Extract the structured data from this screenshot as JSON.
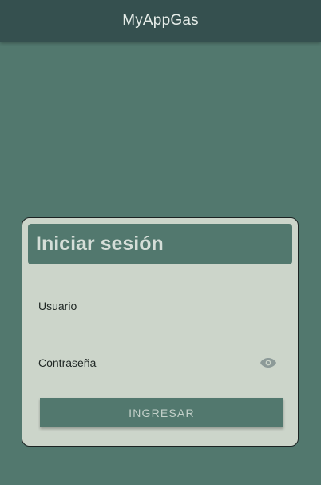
{
  "app_bar": {
    "title": "MyAppGas"
  },
  "login_card": {
    "title": "Iniciar sesión",
    "username": {
      "label": "Usuario",
      "value": ""
    },
    "password": {
      "label": "Contraseña",
      "value": "",
      "toggle_icon": "eye-icon"
    },
    "submit_label": "INGRESAR"
  },
  "colors": {
    "background": "#52786e",
    "app_bar": "#35504f",
    "card": "#ccd5ca",
    "button": "#52786e",
    "eye_icon": "#8c9a98"
  }
}
